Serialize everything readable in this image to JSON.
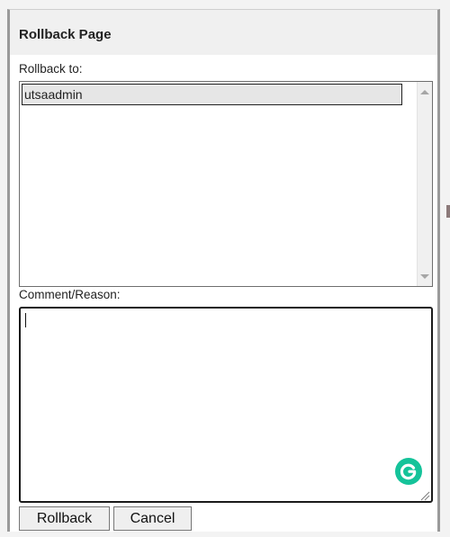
{
  "dialog": {
    "title": "Rollback Page"
  },
  "rollback_to": {
    "label": "Rollback to:",
    "items": [
      {
        "label": "utsaadmin",
        "selected": true
      }
    ]
  },
  "comment": {
    "label": "Comment/Reason:",
    "value": ""
  },
  "buttons": {
    "rollback": "Rollback",
    "cancel": "Cancel"
  },
  "icons": {
    "scroll_up": "scroll-up-icon",
    "scroll_down": "scroll-down-icon",
    "grammarly": "grammarly-icon",
    "resize": "resize-grip-icon"
  },
  "colors": {
    "grammarly": "#15c39a",
    "selected_item": "#e6e6e6"
  }
}
